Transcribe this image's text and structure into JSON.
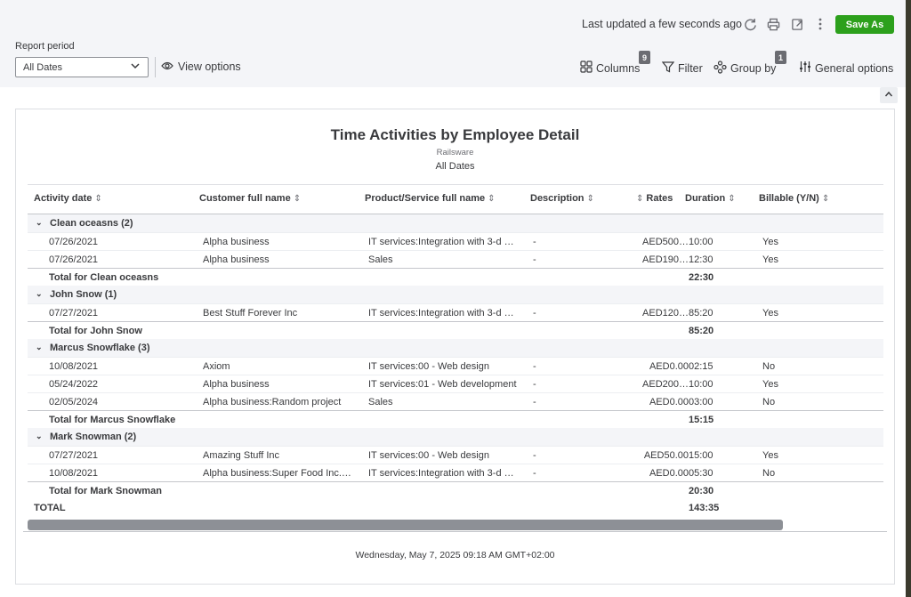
{
  "header": {
    "status": "Last updated a few seconds ago",
    "save_label": "Save As",
    "icons": [
      "refresh-icon",
      "print-icon",
      "export-icon",
      "more-icon"
    ]
  },
  "controls": {
    "period_label": "Report period",
    "period_value": "All Dates",
    "view_options": "View options",
    "columns_label": "Columns",
    "columns_count": "9",
    "filter_label": "Filter",
    "groupby_label": "Group by",
    "groupby_count": "1",
    "general_label": "General options"
  },
  "report": {
    "title": "Time Activities by Employee Detail",
    "company": "Railsware",
    "period": "All Dates",
    "columns": [
      "Activity date",
      "Customer full name",
      "Product/Service full name",
      "Description",
      "Rates",
      "Duration",
      "Billable (Y/N)"
    ],
    "groups": [
      {
        "name": "Clean oceasns (2)",
        "rows": [
          {
            "date": "07/26/2021",
            "customer": "Alpha business",
            "product": "IT services:Integration with 3-d …",
            "desc": "-",
            "rate": "AED500…",
            "duration": "10:00",
            "billable": "Yes"
          },
          {
            "date": "07/26/2021",
            "customer": "Alpha business",
            "product": "Sales",
            "desc": "-",
            "rate": "AED190…",
            "duration": "12:30",
            "billable": "Yes"
          }
        ],
        "total_label": "Total for Clean oceasns",
        "total_duration": "22:30"
      },
      {
        "name": "John Snow (1)",
        "rows": [
          {
            "date": "07/27/2021",
            "customer": "Best Stuff Forever Inc",
            "product": "IT services:Integration with 3-d …",
            "desc": "-",
            "rate": "AED120…",
            "duration": "85:20",
            "billable": "Yes"
          }
        ],
        "total_label": "Total for John Snow",
        "total_duration": "85:20"
      },
      {
        "name": "Marcus Snowflake (3)",
        "rows": [
          {
            "date": "10/08/2021",
            "customer": "Axiom",
            "product": "IT services:00 - Web design",
            "desc": "-",
            "rate": "AED0.00",
            "duration": "02:15",
            "billable": "No"
          },
          {
            "date": "05/24/2022",
            "customer": "Alpha business",
            "product": "IT services:01 - Web development",
            "desc": "-",
            "rate": "AED200…",
            "duration": "10:00",
            "billable": "Yes"
          },
          {
            "date": "02/05/2024",
            "customer": "Alpha business:Random project",
            "product": "Sales",
            "desc": "-",
            "rate": "AED0.00",
            "duration": "03:00",
            "billable": "No"
          }
        ],
        "total_label": "Total for Marcus Snowflake",
        "total_duration": "15:15"
      },
      {
        "name": "Mark Snowman (2)",
        "rows": [
          {
            "date": "07/27/2021",
            "customer": "Amazing Stuff Inc",
            "product": "IT services:00 - Web design",
            "desc": "-",
            "rate": "AED50.00",
            "duration": "15:00",
            "billable": "Yes"
          },
          {
            "date": "10/08/2021",
            "customer": "Alpha business:Super Food Inc.…",
            "product": "IT services:Integration with 3-d …",
            "desc": "-",
            "rate": "AED0.00",
            "duration": "05:30",
            "billable": "No"
          }
        ],
        "total_label": "Total for Mark Snowman",
        "total_duration": "20:30"
      }
    ],
    "grand_total_label": "TOTAL",
    "grand_total_duration": "143:35",
    "footer": "Wednesday, May 7, 2025 09:18 AM GMT+02:00"
  }
}
